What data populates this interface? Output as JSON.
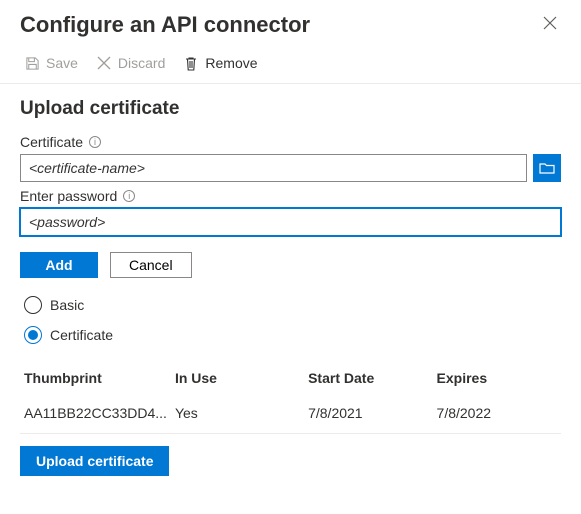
{
  "header": {
    "title": "Configure an API connector"
  },
  "toolbar": {
    "save_label": "Save",
    "discard_label": "Discard",
    "remove_label": "Remove"
  },
  "upload": {
    "section_title": "Upload certificate",
    "certificate_label": "Certificate",
    "certificate_placeholder": "<certificate-name>",
    "password_label": "Enter password",
    "password_placeholder": "<password>",
    "add_label": "Add",
    "cancel_label": "Cancel"
  },
  "auth_options": {
    "basic_label": "Basic",
    "certificate_label": "Certificate",
    "selected": "certificate"
  },
  "table": {
    "headers": {
      "thumbprint": "Thumbprint",
      "in_use": "In Use",
      "start": "Start Date",
      "expires": "Expires"
    },
    "rows": [
      {
        "thumbprint": "AA11BB22CC33DD4...",
        "in_use": "Yes",
        "start": "7/8/2021",
        "expires": "7/8/2022"
      }
    ]
  },
  "footer": {
    "upload_button": "Upload certificate"
  }
}
